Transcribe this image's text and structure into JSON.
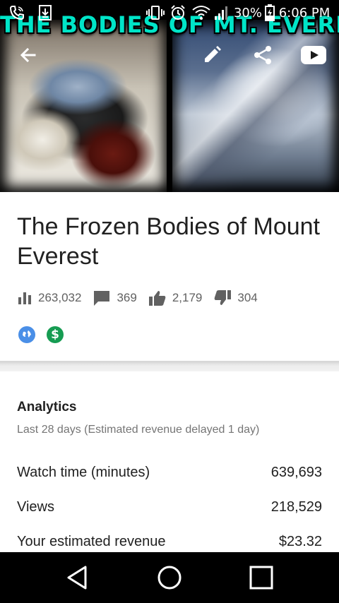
{
  "status_bar": {
    "battery_percent": "30%",
    "time": "6:06 PM"
  },
  "thumbnail": {
    "overlay_text": "THE BODIES OF MT. EVEREST"
  },
  "toolbar": {
    "back_icon": "arrow-back-icon",
    "edit_icon": "pencil-icon",
    "share_icon": "share-icon",
    "youtube_icon": "youtube-icon"
  },
  "video": {
    "title": "The Frozen Bodies of Mount Everest",
    "stats": {
      "views": "263,032",
      "comments": "369",
      "likes": "2,179",
      "dislikes": "304"
    },
    "badges": [
      "globe-icon",
      "dollar-icon"
    ],
    "colors": {
      "public": "#4a8fe7",
      "monetized": "#169c52"
    }
  },
  "analytics": {
    "heading": "Analytics",
    "subtitle": "Last 28 days (Estimated revenue delayed 1 day)",
    "metrics": [
      {
        "label": "Watch time (minutes)",
        "value": "639,693"
      },
      {
        "label": "Views",
        "value": "218,529"
      },
      {
        "label": "Your estimated revenue",
        "value": "$23.32"
      }
    ]
  },
  "nav_bar": {
    "icons": [
      "back-triangle-icon",
      "home-circle-icon",
      "recents-square-icon"
    ]
  }
}
